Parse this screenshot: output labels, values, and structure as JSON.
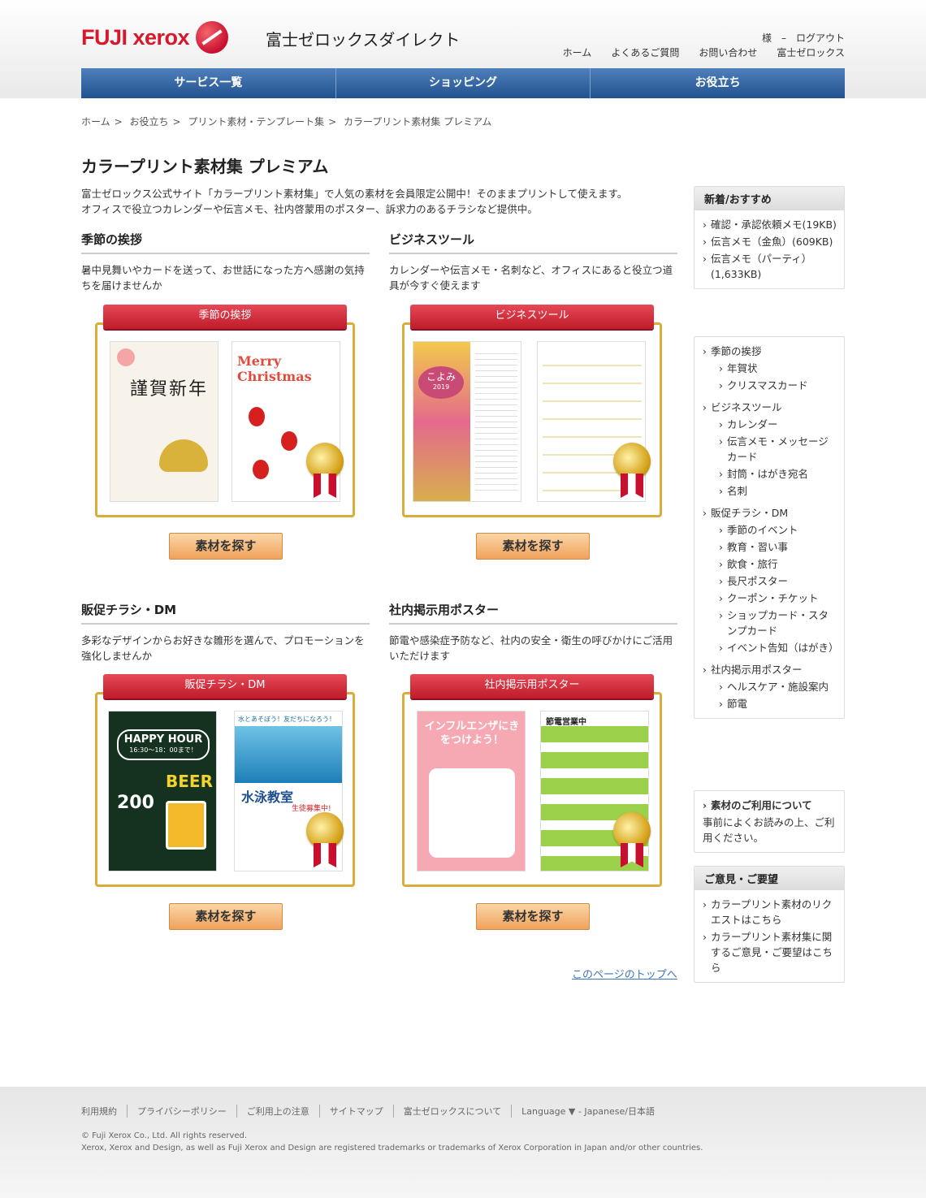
{
  "header": {
    "logo_text": "FUJI xerox",
    "site_name": "富士ゼロックスダイレクト",
    "user_text": "様　–　ログアウト",
    "links": [
      "ホーム",
      "よくあるご質問",
      "お問い合わせ",
      "富士ゼロックス"
    ]
  },
  "mainnav": [
    "サービス一覧",
    "ショッピング",
    "お役立ち"
  ],
  "breadcrumb": [
    "ホーム",
    "お役立ち",
    "プリント素材・テンプレート集",
    "カラープリント素材集 プレミアム"
  ],
  "page_title": "カラープリント素材集 プレミアム",
  "intro": [
    "富士ゼロックス公式サイト「カラープリント素材集」で人気の素材を会員限定公開中！そのままプリントして使えます。",
    "オフィスで役立つカレンダーや伝言メモ、社内啓蒙用のポスター、訴求力のあるチラシなど提供中。"
  ],
  "sections": [
    {
      "title": "季節の挨拶",
      "desc": "暑中見舞いやカードを送って、お世話になった方へ感謝の気持ちを届けませんか",
      "ribbon": "季節の挨拶",
      "button": "素材を探す",
      "card1": "謹賀新年",
      "card2": "Merry Christmas"
    },
    {
      "title": "ビジネスツール",
      "desc": "カレンダーや伝言メモ・名刺など、オフィスにあると役立つ道具が今すぐ使えます",
      "ribbon": "ビジネスツール",
      "button": "素材を探す",
      "card1": "こよみ",
      "card2": ""
    },
    {
      "title": "販促チラシ・DM",
      "desc": "多彩なデザインからお好きな雛形を選んで、プロモーションを強化しませんか",
      "ribbon": "販促チラシ・DM",
      "button": "素材を探す",
      "card1": "HAPPY HOUR",
      "card2": "水泳教室"
    },
    {
      "title": "社内掲示用ポスター",
      "desc": "節電や感染症予防など、社内の安全・衛生の呼びかけにご活用いただけます",
      "ribbon": "社内掲示用ポスター",
      "button": "素材を探す",
      "card1": "インフルエンザにきをつけよう！",
      "card2": "節電営業中"
    }
  ],
  "card_extra": {
    "kotoshi": "2019",
    "happy_time": "16:30～18：00まで！",
    "beer": "BEER",
    "beer_num": "200",
    "swim_top": "水とあそぼう！友だちになろう！",
    "swim_sub": "生徒募集中!"
  },
  "totop": "このページのトップへ",
  "sidebar": {
    "new_title": "新着/おすすめ",
    "new_items": [
      "確認・承認依頼メモ(19KB)",
      "伝言メモ（金魚）(609KB)",
      "伝言メモ（パーティ）(1,633KB)"
    ],
    "cats": [
      {
        "label": "季節の挨拶",
        "sub": false
      },
      {
        "label": "年賀状",
        "sub": true
      },
      {
        "label": "クリスマスカード",
        "sub": true
      },
      {
        "label": "ビジネスツール",
        "sub": false
      },
      {
        "label": "カレンダー",
        "sub": true
      },
      {
        "label": "伝言メモ・メッセージカード",
        "sub": true
      },
      {
        "label": "封筒・はがき宛名",
        "sub": true
      },
      {
        "label": "名刺",
        "sub": true
      },
      {
        "label": "販促チラシ・DM",
        "sub": false
      },
      {
        "label": "季節のイベント",
        "sub": true
      },
      {
        "label": "教育・習い事",
        "sub": true
      },
      {
        "label": "飲食・旅行",
        "sub": true
      },
      {
        "label": "長尺ポスター",
        "sub": true
      },
      {
        "label": "クーポン・チケット",
        "sub": true
      },
      {
        "label": "ショップカード・スタンプカード",
        "sub": true
      },
      {
        "label": "イベント告知（はがき）",
        "sub": true
      },
      {
        "label": "社内掲示用ポスター",
        "sub": false
      },
      {
        "label": "ヘルスケア・施設案内",
        "sub": true
      },
      {
        "label": "節電",
        "sub": true
      }
    ],
    "usage_title": "素材のご利用について",
    "usage_text": "事前によくお読みの上、ご利用ください。",
    "feedback_title": "ご意見・ご要望",
    "feedback_items": [
      "カラープリント素材のリクエストはこちら",
      "カラープリント素材集に関するご意見・ご要望はこちら"
    ]
  },
  "footer": {
    "links": [
      "利用規約",
      "プライバシーポリシー",
      "ご利用上の注意",
      "サイトマップ",
      "富士ゼロックスについて",
      "Language ▼  - Japanese/日本語"
    ],
    "copyright": "© Fuji Xerox Co., Ltd. All rights reserved.",
    "trademark": "Xerox, Xerox and Design, as well as Fuji Xerox and Design are registered trademarks or trademarks of Xerox Corporation in Japan and/or other countries."
  }
}
